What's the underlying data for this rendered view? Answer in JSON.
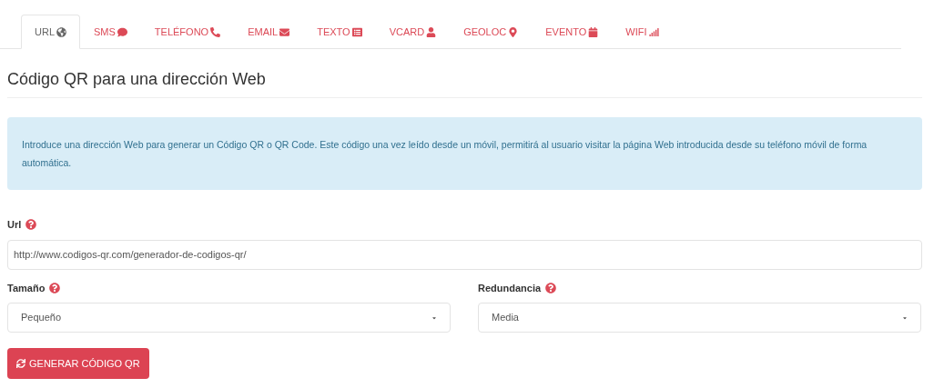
{
  "tabs": [
    {
      "label": "URL",
      "selected": true
    },
    {
      "label": "SMS",
      "selected": false
    },
    {
      "label": "TELÉFONO",
      "selected": false
    },
    {
      "label": "EMAIL",
      "selected": false
    },
    {
      "label": "TEXTO",
      "selected": false
    },
    {
      "label": "VCARD",
      "selected": false
    },
    {
      "label": "GEOLOC",
      "selected": false
    },
    {
      "label": "EVENTO",
      "selected": false
    },
    {
      "label": "WIFI",
      "selected": false
    }
  ],
  "heading": "Código QR para una dirección Web",
  "info": "Introduce una dirección Web para generar un Código QR o QR Code. Este código una vez leído desde un móvil, permitirá al usuario visitar la página Web introducida desde su teléfono móvil de forma automática.",
  "url_field": {
    "label": "Url",
    "value": "http://www.codigos-qr.com/generador-de-codigos-qr/"
  },
  "selects": [
    {
      "label": "Tamaño",
      "value": "Pequeño"
    },
    {
      "label": "Redundancia",
      "value": "Media"
    }
  ],
  "button": {
    "label": "GENERAR CÓDIGO QR"
  }
}
